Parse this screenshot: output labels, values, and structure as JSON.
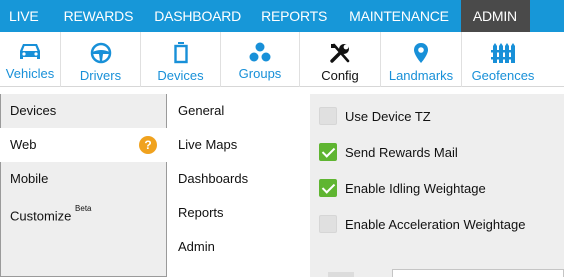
{
  "topnav": {
    "items": [
      {
        "label": "LIVE"
      },
      {
        "label": "REWARDS"
      },
      {
        "label": "DASHBOARD"
      },
      {
        "label": "REPORTS"
      },
      {
        "label": "MAINTENANCE"
      },
      {
        "label": "ADMIN",
        "active": true
      }
    ]
  },
  "toolbar": {
    "items": [
      {
        "label": "Vehicles",
        "icon": "car-icon"
      },
      {
        "label": "Drivers",
        "icon": "steering-wheel-icon"
      },
      {
        "label": "Devices",
        "icon": "device-icon"
      },
      {
        "label": "Groups",
        "icon": "groups-icon"
      },
      {
        "label": "Config",
        "icon": "tools-icon",
        "active": true
      },
      {
        "label": "Landmarks",
        "icon": "map-pin-icon"
      },
      {
        "label": "Geofences",
        "icon": "fence-icon"
      }
    ]
  },
  "leftmenu": {
    "items": [
      {
        "label": "Devices"
      },
      {
        "label": "Web",
        "active": true
      },
      {
        "label": "Mobile"
      },
      {
        "label": "Customize",
        "sup": "Beta"
      }
    ],
    "help_icon": "?"
  },
  "submenu": {
    "items": [
      {
        "label": "General",
        "active": true
      },
      {
        "label": "Live Maps"
      },
      {
        "label": "Dashboards"
      },
      {
        "label": "Reports"
      },
      {
        "label": "Admin"
      }
    ]
  },
  "options": [
    {
      "label": "Use Device TZ",
      "checked": false
    },
    {
      "label": "Send Rewards Mail",
      "checked": true
    },
    {
      "label": "Enable Idling Weightage",
      "checked": true
    },
    {
      "label": "Enable Acceleration Weightage",
      "checked": false
    }
  ],
  "colors": {
    "nav_bg": "#1797d8",
    "nav_active": "#4a4a4a",
    "icon_blue": "#1890d8",
    "check_green": "#5fb531",
    "help_orange": "#f0a21e",
    "panel_gray": "#eeeeee"
  }
}
